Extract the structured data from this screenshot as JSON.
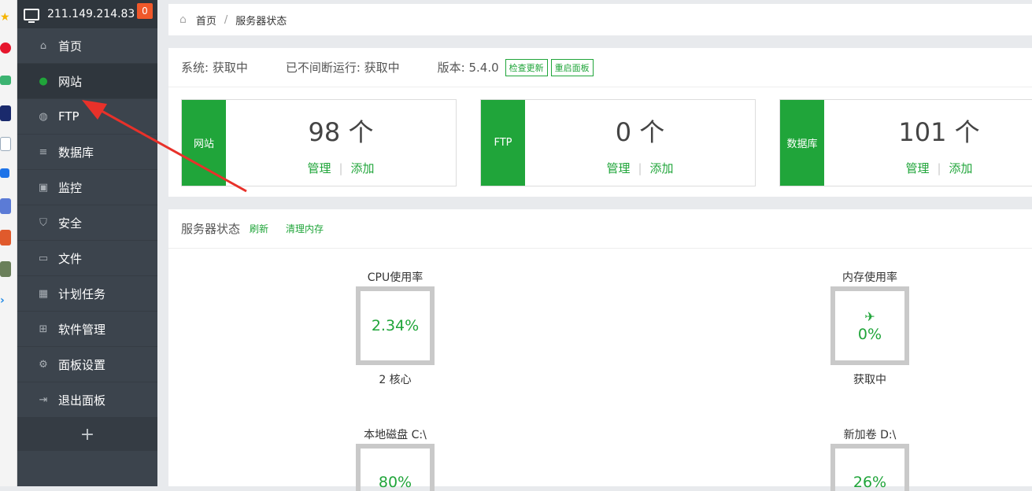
{
  "header": {
    "ip": "211.149.214.83",
    "badge": "0"
  },
  "sidebar": {
    "items": [
      {
        "label": "首页",
        "icon": "home-icon"
      },
      {
        "label": "网站",
        "icon": "globe-icon"
      },
      {
        "label": "FTP",
        "icon": "ftp-icon"
      },
      {
        "label": "数据库",
        "icon": "database-icon"
      },
      {
        "label": "监控",
        "icon": "monitor-chart-icon"
      },
      {
        "label": "安全",
        "icon": "shield-icon"
      },
      {
        "label": "文件",
        "icon": "folder-icon"
      },
      {
        "label": "计划任务",
        "icon": "calendar-icon"
      },
      {
        "label": "软件管理",
        "icon": "grid-icon"
      },
      {
        "label": "面板设置",
        "icon": "gear-icon"
      },
      {
        "label": "退出面板",
        "icon": "logout-icon"
      }
    ],
    "add": "+"
  },
  "breadcrumb": {
    "home": "首页",
    "sep": "/",
    "current": "服务器状态"
  },
  "sysinfo": {
    "system": "系统: 获取中",
    "uptime": "已不间断运行: 获取中",
    "version": "版本: 5.4.0",
    "check_update": "检查更新",
    "restart": "重启面板"
  },
  "stats": [
    {
      "label": "网站",
      "count": "98 个",
      "manage": "管理",
      "add": "添加",
      "sep": "|"
    },
    {
      "label": "FTP",
      "count": "0 个",
      "manage": "管理",
      "add": "添加",
      "sep": "|"
    },
    {
      "label": "数据库",
      "count": "101 个",
      "manage": "管理",
      "add": "添加",
      "sep": "|"
    }
  ],
  "status": {
    "title": "服务器状态",
    "refresh": "刷新",
    "clear_mem": "清理内存",
    "gauges": [
      {
        "title": "CPU使用率",
        "value": "2.34%",
        "sub": "2 核心"
      },
      {
        "title": "内存使用率",
        "value": "0%",
        "sub": "获取中"
      },
      {
        "title": "本地磁盘 C:\\",
        "value": "80%",
        "sub": ""
      },
      {
        "title": "新加卷 D:\\",
        "value": "26%",
        "sub": ""
      }
    ]
  },
  "colors": {
    "accent": "#20a53a",
    "sidebar": "#3c444d",
    "badge": "#f0582a",
    "arrow": "#e8312a"
  }
}
